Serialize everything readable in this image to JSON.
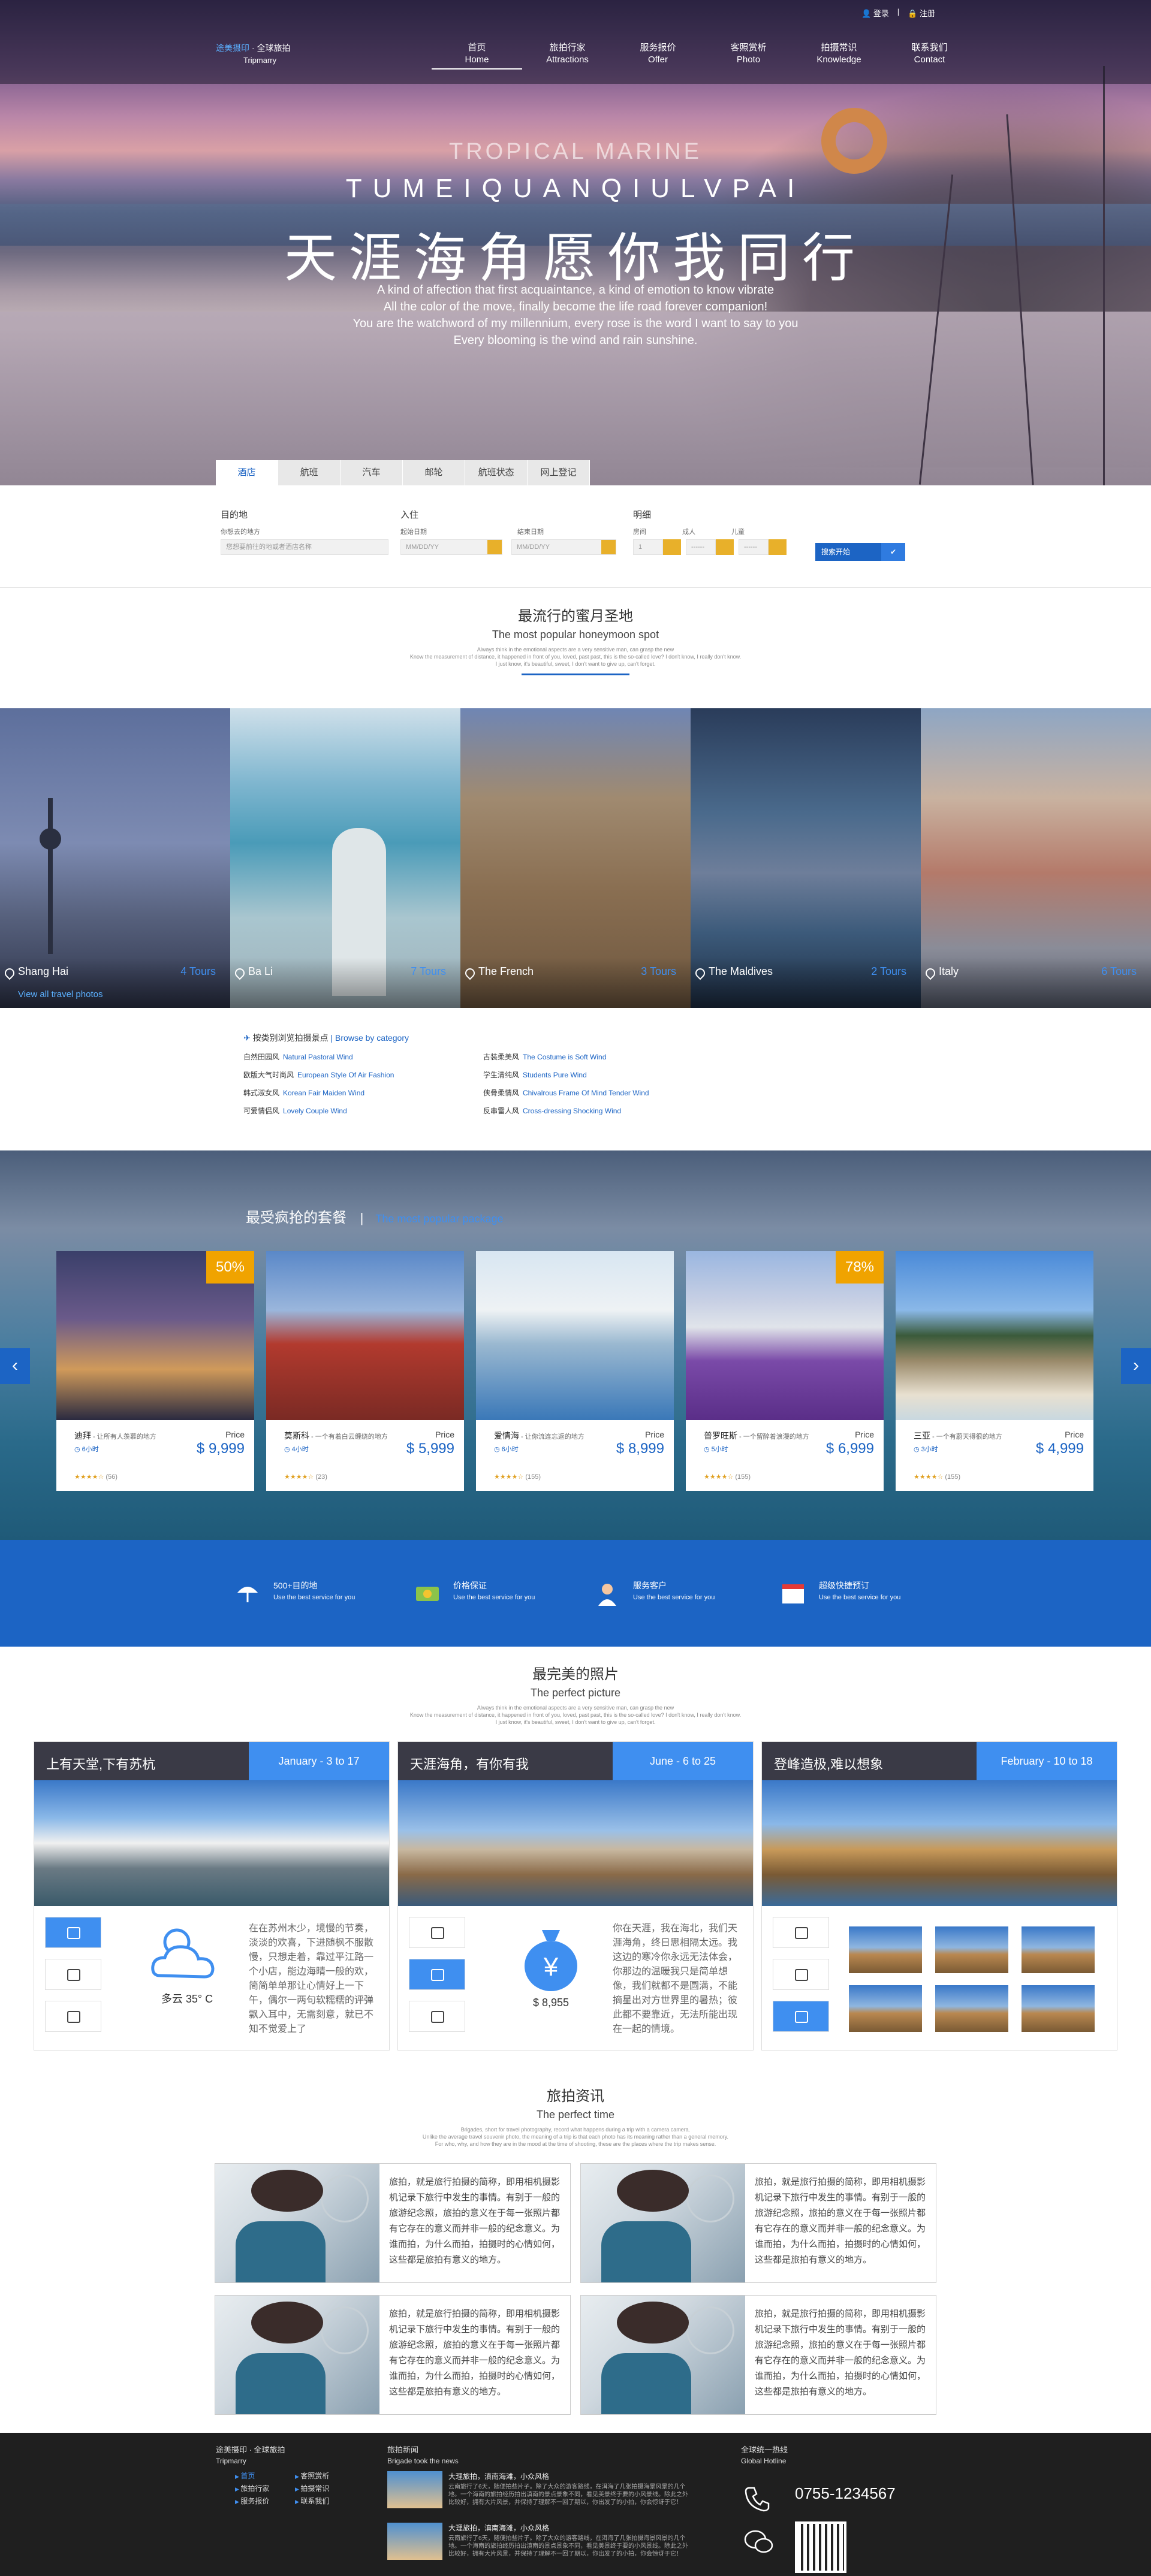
{
  "topbar": {
    "login": "登录",
    "register": "注册"
  },
  "logo": {
    "cn_brand": "途美摄印",
    "cn_rest": " · 全球旅拍",
    "en": "Tripmarry"
  },
  "nav": [
    {
      "cn": "首页",
      "en": "Home"
    },
    {
      "cn": "旅拍行家",
      "en": "Attractions"
    },
    {
      "cn": "服务报价",
      "en": "Offer"
    },
    {
      "cn": "客照赏析",
      "en": "Photo"
    },
    {
      "cn": "拍摄常识",
      "en": "Knowledge"
    },
    {
      "cn": "联系我们",
      "en": "Contact"
    }
  ],
  "hero": {
    "line1": "TROPICAL MARINE",
    "line2": "TUMEIQUANQIULVPAI",
    "line3": "天涯海角愿你我同行",
    "line4": "A kind of affection that first acquaintance, a kind of emotion to know vibrate",
    "line5": "All the color of the move, finally become the life road forever companion!",
    "line6": "You are the watchword of my millennium, every rose is the word I want to say to you",
    "line7": "Every blooming is the wind and rain sunshine."
  },
  "tabs": [
    "酒店",
    "航班",
    "汽车",
    "邮轮",
    "航班状态",
    "网上登记"
  ],
  "search": {
    "dest_label": "目的地",
    "dest_sub": "你想去的地方",
    "dest_placeholder": "您想要前往的地或者酒店名称",
    "checkin_label": "入住",
    "checkin_sub": "起始日期",
    "checkout_sub": "结束日期",
    "date_placeholder": "MM/DD/YY",
    "detail_label": "明细",
    "rooms_sub": "房间",
    "rooms_val": "1",
    "adult_sub": "成人",
    "adult_val": "------",
    "child_sub": "儿童",
    "child_val": "------",
    "button": "搜索开始"
  },
  "honeymoon": {
    "cn": "最流行的蜜月圣地",
    "en": "The most popular honeymoon spot",
    "desc1": "Always think in the emotional aspects are a very sensitive man, can grasp the new",
    "desc2": "Know the measurement of distance, it happened in front of you, loved, past past, this is the so-called love? I don't know, I really don't know.",
    "desc3": "I just know, it's beautiful, sweet, I don't want to give up, can't forget."
  },
  "destinations": [
    {
      "name": "Shang Hai",
      "tours": "4 Tours",
      "view": "View all travel photos"
    },
    {
      "name": "Ba Li",
      "tours": "7 Tours"
    },
    {
      "name": "The French",
      "tours": "3 Tours"
    },
    {
      "name": "The Maldives",
      "tours": "2 Tours"
    },
    {
      "name": "Italy",
      "tours": "6 Tours"
    }
  ],
  "categories": {
    "head_cn": "按类别浏览拍摄景点",
    "head_en": "Browse by category",
    "rows": [
      [
        {
          "cn": "自然田园风",
          "en": "Natural Pastoral Wind"
        },
        {
          "cn": "古装柔美风",
          "en": "The Costume is Soft Wind"
        }
      ],
      [
        {
          "cn": "欧版大气时尚风",
          "en": "European Style Of Air Fashion"
        },
        {
          "cn": "学生清纯风",
          "en": "Students Pure Wind"
        }
      ],
      [
        {
          "cn": "韩式淑女风",
          "en": "Korean Fair Maiden Wind"
        },
        {
          "cn": "侠骨柔情风",
          "en": "Chivalrous Frame Of Mind Tender Wind"
        }
      ],
      [
        {
          "cn": "可爱情侣风",
          "en": "Lovely Couple Wind"
        },
        {
          "cn": "反串雷人风",
          "en": "Cross-dressing Shocking Wind"
        }
      ]
    ]
  },
  "deals": {
    "title": "最受疯抢的套餐",
    "title_en": "The most popular package",
    "cards": [
      {
        "badge": "50%",
        "name": "迪拜",
        "slogan": " - 让所有人羡慕的地方",
        "duration": "6小时",
        "price_label": "Price",
        "price": "$ 9,999",
        "stars": "★★★★☆",
        "reviews": "(56)"
      },
      {
        "name": "莫斯科",
        "slogan": " - 一个有着白云缠绕的地方",
        "duration": "4小时",
        "price_label": "Price",
        "price": "$ 5,999",
        "stars": "★★★★☆",
        "reviews": "(23)"
      },
      {
        "name": "爱情海",
        "slogan": " - 让你流连忘返的地方",
        "duration": "6小时",
        "price_label": "Price",
        "price": "$ 8,999",
        "stars": "★★★★☆",
        "reviews": "(155)"
      },
      {
        "badge": "78%",
        "name": "普罗旺斯",
        "slogan": " - 一个留醉着浪漫的地方",
        "duration": "5小时",
        "price_label": "Price",
        "price": "$ 6,999",
        "stars": "★★★★☆",
        "reviews": "(155)"
      },
      {
        "name": "三亚",
        "slogan": " - 一个有蔚天得很的地方",
        "duration": "3小时",
        "price_label": "Price",
        "price": "$ 4,999",
        "stars": "★★★★☆",
        "reviews": "(155)"
      }
    ]
  },
  "features": [
    {
      "title": "500+目的地",
      "sub": "Use the best service for you"
    },
    {
      "title": "价格保证",
      "sub": "Use the best service for you"
    },
    {
      "title": "服务客户",
      "sub": "Use the best service for you"
    },
    {
      "title": "超级快捷预订",
      "sub": "Use the best service for you"
    }
  ],
  "perfect": {
    "cn": "最完美的照片",
    "en": "The perfect picture",
    "desc1": "Always think in the emotional aspects are a very sensitive man, can grasp the new",
    "desc2": "Know the measurement of distance, it happened in front of you, loved, past past, this is the so-called love? I don't know, I really don't know.",
    "desc3": "I just know, it's beautiful, sweet, I don't want to give up, can't forget."
  },
  "photos": [
    {
      "title": "上有天堂,下有苏杭",
      "date": "January - 3 to 17",
      "big_label": "多云 35° C",
      "text": "在在苏州木少，境慢的节奏，淡淡的欢喜，下进随枫不服散慢，只想走着，靠过平江路一个小店，能边海晴一般的欢，简简单单那让心情好上一下午，偶尔一两句软糯糯的评弹飘入耳中，无需刻意，就已不知不觉爱上了"
    },
    {
      "title": "天涯海角，有你有我",
      "date": "June - 6 to 25",
      "big_label": "$ 8,955",
      "text": "你在天涯，我在海北，我们天涯海角，终日思相隔太远。我这边的寒冷你永远无法体会，你那边的温暖我只是简单想像，我们就都不是圆满，不能摘星出对方世界里的暑热；彼此都不要靠近，无法所能出现在一起的情境。"
    },
    {
      "title": "登峰造极,难以想象",
      "date": "February - 10 to 18"
    }
  ],
  "news": {
    "cn": "旅拍资讯",
    "en": "The perfect time",
    "desc1": "Brigades, short for travel photography, record what happens during a trip with a camera camera.",
    "desc2": "Unlike the average travel souvenir photo, the meaning of a trip is that each photo has its meaning rather than a general memory.",
    "desc3": "For who, why, and how they are in the mood at the time of shooting, these are the places where the trip makes sense.",
    "item_text": "旅拍，就是旅行拍摄的简称，即用相机摄影机记录下旅行中发生的事情。有别于一般的旅游纪念照，旅拍的意义在于每一张照片都有它存在的意义而并非一般的纪念意义。为谁而拍，为什么而拍，拍摄时的心情如何，这些都是旅拍有意义的地方。"
  },
  "footer": {
    "brand": "途美摄印 · 全球旅拍",
    "brand_en": "Tripmarry",
    "links": [
      "首页",
      "旅拍行家",
      "服务报价",
      "客照赏析",
      "拍摄常识",
      "联系我们"
    ],
    "news_cn": "旅拍新闻",
    "news_en": "Brigade took the news",
    "news_items": [
      {
        "t": "大理旅拍，滇南海滩，小众风格",
        "s": "云南旅行了6天，随便拍些片子。除了大众的游客路线，在洱海了几张拍摄海景风景的几个地。一个海南的旅拍经历拍出滇南的景点景象不同，看见美景终于要的小风景线。除此之外比较好，拥有大片风景，并保持了理解不一回了期以，你出发了的小拍，你会惊讶于它！"
      },
      {
        "t": "大理旅拍，滇南海滩，小众风格",
        "s": "云南旅行了6天，随便拍些片子。除了大众的游客路线，在洱海了几张拍摄海景风景的几个地。一个海南的旅拍经历拍出滇南的景点景象不同，看见美景终于要的小风景线。除此之外比较好，拥有大片风景，并保持了理解不一回了期以，你出发了的小拍，你会惊讶于它！"
      }
    ],
    "hotline_cn": "全球统一热线",
    "hotline_en": "Global Hotline",
    "phone": "0755-1234567"
  },
  "colors": {
    "brand": "#1c64c4",
    "accent": "#3f8ff0",
    "badge": "#f0a300"
  }
}
